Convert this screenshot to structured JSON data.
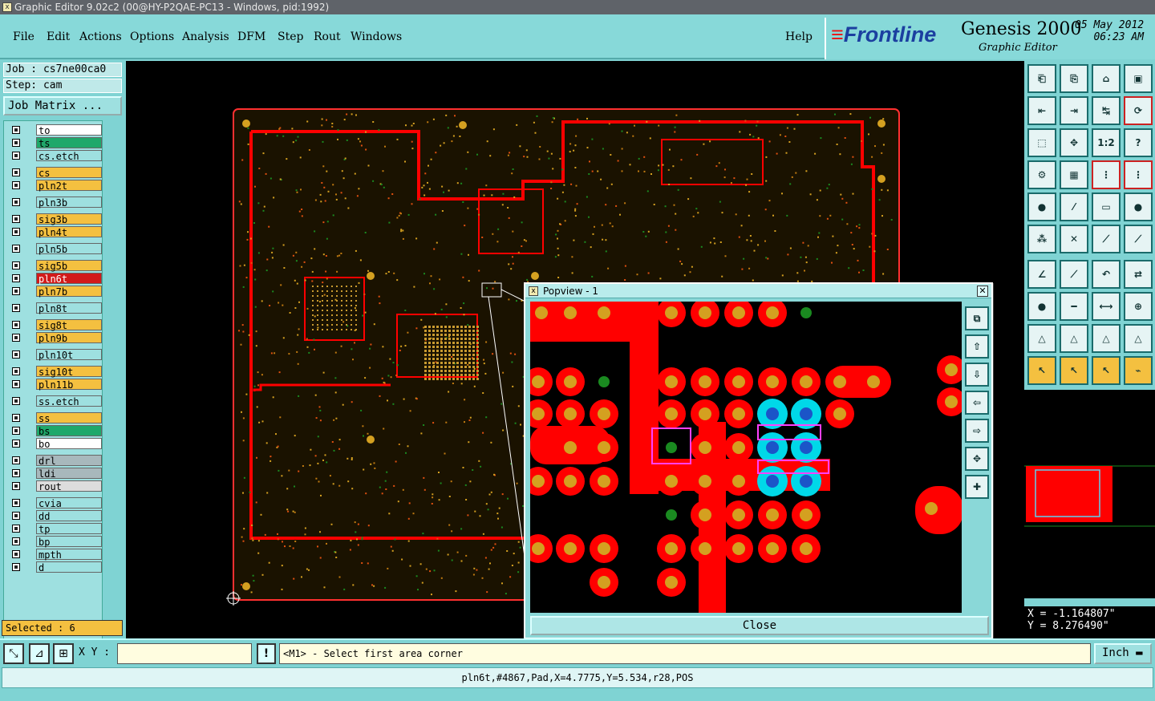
{
  "window_title": "Graphic Editor 9.02c2 (00@HY-P2QAE-PC13 - Windows, pid:1992)",
  "menu": [
    "File",
    "Edit",
    "Actions",
    "Options",
    "Analysis",
    "DFM",
    "Step",
    "Rout",
    "Windows"
  ],
  "help_label": "Help",
  "brand": {
    "logo": "Frontline",
    "product": "Genesis 2000",
    "subtitle": "Graphic Editor",
    "date": "05 May 2012",
    "time": "06:23 AM"
  },
  "job": "Job : cs7ne00ca0",
  "step": "Step: cam",
  "job_matrix_label": "Job Matrix ...",
  "layers": [
    {
      "name": "to",
      "color": "#ffffff"
    },
    {
      "name": "ts",
      "color": "#1fa86a"
    },
    {
      "name": "cs.etch",
      "color": "#9ee0e0"
    },
    {
      "name": "cs",
      "color": "#f4c040"
    },
    {
      "name": "pln2t",
      "color": "#f4c040"
    },
    {
      "name": "pln3b",
      "color": "#9ee0e0"
    },
    {
      "name": "sig3b",
      "color": "#f4c040"
    },
    {
      "name": "pln4t",
      "color": "#f4c040"
    },
    {
      "name": "pln5b",
      "color": "#9ee0e0"
    },
    {
      "name": "sig5b",
      "color": "#f4c040"
    },
    {
      "name": "pln6t",
      "color": "#d21a1a"
    },
    {
      "name": "pln7b",
      "color": "#f4c040"
    },
    {
      "name": "pln8t",
      "color": "#9ee0e0"
    },
    {
      "name": "sig8t",
      "color": "#f4c040"
    },
    {
      "name": "pln9b",
      "color": "#f4c040"
    },
    {
      "name": "pln10t",
      "color": "#9ee0e0"
    },
    {
      "name": "sig10t",
      "color": "#f4c040"
    },
    {
      "name": "pln11b",
      "color": "#f4c040"
    },
    {
      "name": "ss.etch",
      "color": "#9ee0e0"
    },
    {
      "name": "ss",
      "color": "#f4c040"
    },
    {
      "name": "bs",
      "color": "#1fa86a"
    },
    {
      "name": "bo",
      "color": "#ffffff"
    },
    {
      "name": "drl",
      "color": "#a8b8bc"
    },
    {
      "name": "ldi",
      "color": "#a8b8bc"
    },
    {
      "name": "rout",
      "color": "#dddddd"
    },
    {
      "name": "cvia",
      "color": "#9ee0e0"
    },
    {
      "name": "dd",
      "color": "#9ee0e0"
    },
    {
      "name": "tp",
      "color": "#9ee0e0"
    },
    {
      "name": "bp",
      "color": "#9ee0e0"
    },
    {
      "name": "mpth",
      "color": "#9ee0e0"
    },
    {
      "name": "d",
      "color": "#9ee0e0"
    }
  ],
  "selected": "Selected : 6",
  "popup": {
    "title": "Popview - 1",
    "close_label": "Close"
  },
  "coords": {
    "x": "X = -1.164807\"",
    "y": "Y = 8.276490\""
  },
  "toolbar_extra": {
    "ratio_label": "1:2"
  },
  "xy_label": "X Y :",
  "xy_value": "",
  "prompt": "<M1> - Select first area corner",
  "units": "Inch",
  "status": "pln6t,#4867,Pad,X=4.7775,Y=5.534,r28,POS",
  "colors": {
    "copper": "#ff0000",
    "pad": "#d4a020",
    "via": "#00d8e8",
    "green": "#1a8a20",
    "select": "#ff40ff"
  }
}
